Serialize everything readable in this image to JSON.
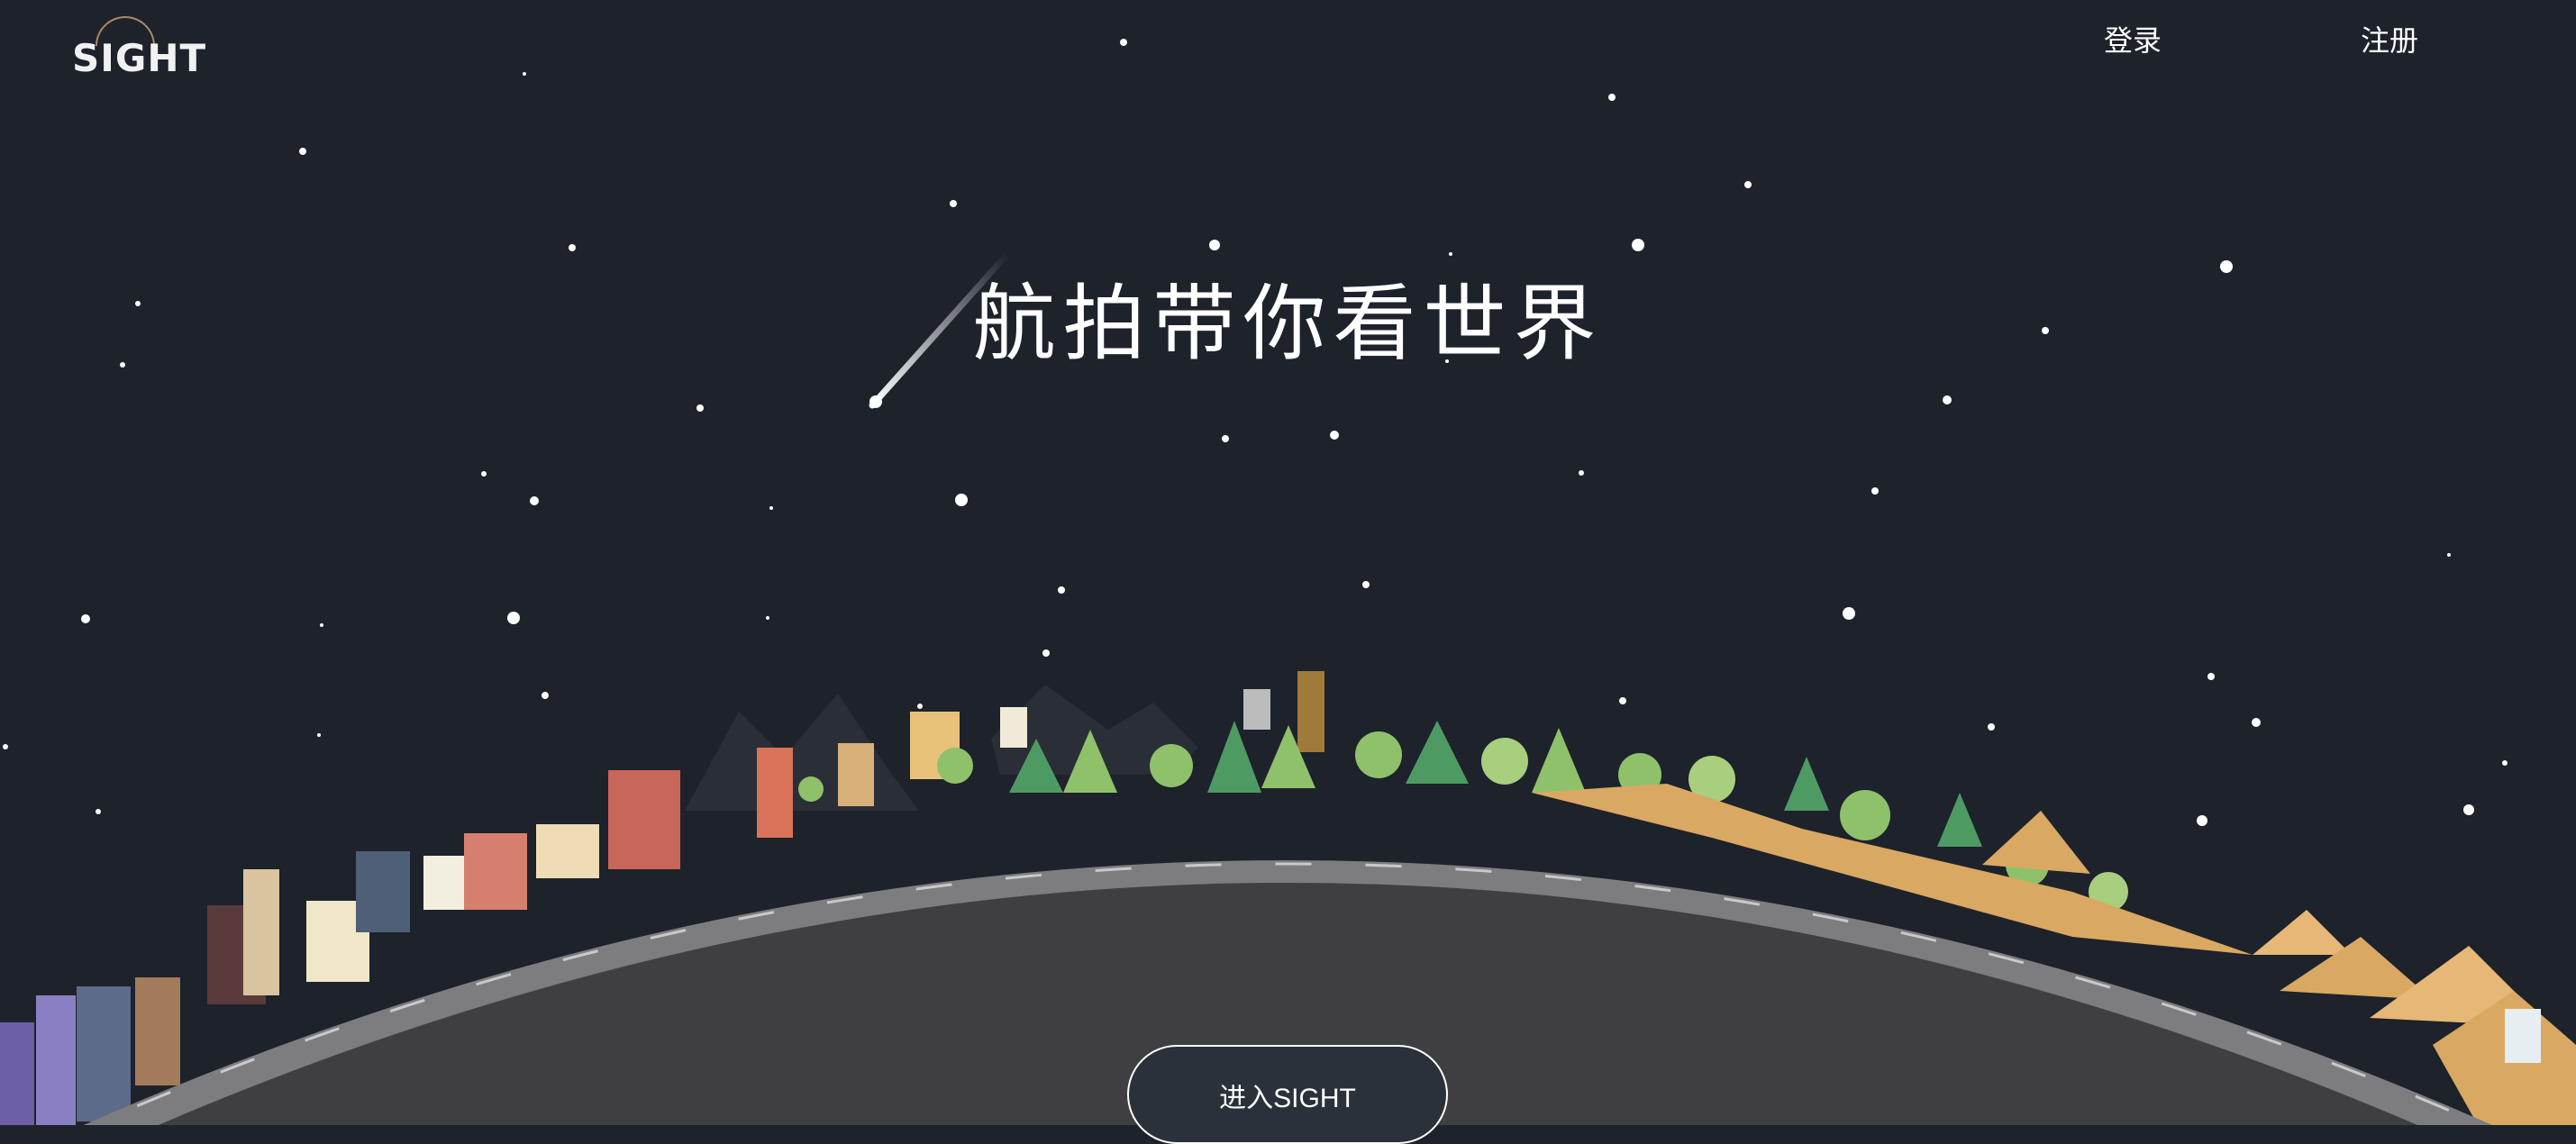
{
  "brand": {
    "logo_text": "SIGHT"
  },
  "nav": {
    "login_label": "登录",
    "register_label": "注册"
  },
  "hero": {
    "title": "航拍带你看世界",
    "enter_label": "进入SIGHT"
  },
  "colors": {
    "background": "#1d222b",
    "planet": "#3f3f41",
    "road": "#7d7d80",
    "tree_light": "#8fc16b",
    "tree_dark": "#4e9a63",
    "pyramid": "#d9a862"
  }
}
